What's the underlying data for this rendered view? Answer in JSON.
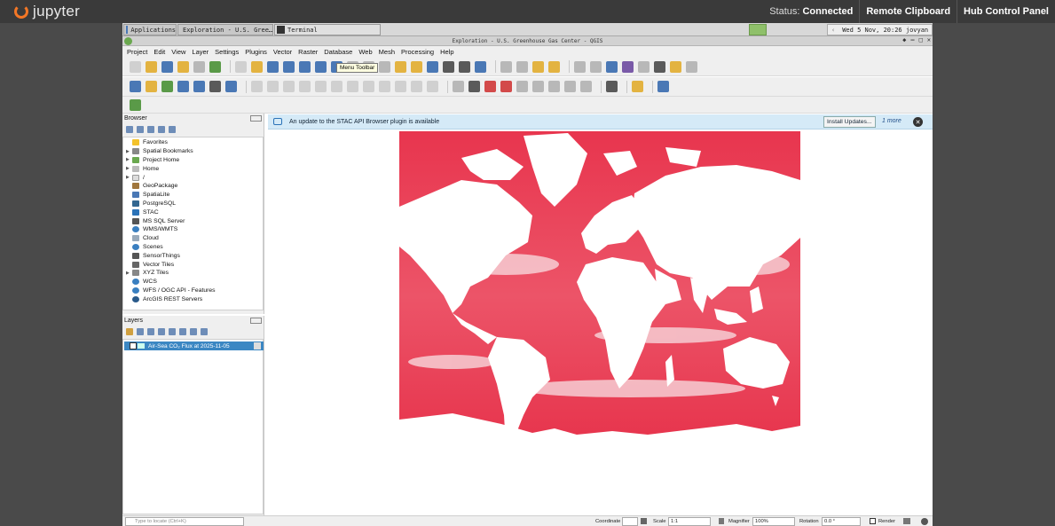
{
  "jupyter": {
    "logo_text": "jupyter",
    "status_label": "Status:",
    "status_value": "Connected",
    "buttons": [
      "Remote Clipboard",
      "Hub Control Panel"
    ]
  },
  "taskbar": {
    "tasks": [
      "Applications",
      "Exploration - U.S. Gree…",
      "Terminal"
    ],
    "clock": "Wed  5 Nov, 20:26  jovyan"
  },
  "window": {
    "title": "Exploration - U.S. Greenhouse Gas Center - QGIS",
    "controls": [
      "◆",
      "–",
      "□",
      "✕"
    ]
  },
  "menu": {
    "items": [
      "Project",
      "Edit",
      "View",
      "Layer",
      "Settings",
      "Plugins",
      "Vector",
      "Raster",
      "Database",
      "Web",
      "Mesh",
      "Processing",
      "Help"
    ],
    "tooltip": "Menu Toolbar"
  },
  "browser": {
    "title": "Browser",
    "items": [
      "Favorites",
      "Spatial Bookmarks",
      "Project Home",
      "Home",
      "/",
      "GeoPackage",
      "SpatiaLite",
      "PostgreSQL",
      "STAC",
      "MS SQL Server",
      "WMS/WMTS",
      "Cloud",
      "Scenes",
      "SensorThings",
      "Vector Tiles",
      "XYZ Tiles",
      "WCS",
      "WFS / OGC API - Features",
      "ArcGIS REST Servers"
    ]
  },
  "layers": {
    "title": "Layers",
    "layer_name": "Air-Sea CO₂ Flux at 2025-11-05"
  },
  "notice": {
    "text": "An update to the STAC API Browser plugin is available",
    "install_label": "Install Updates...",
    "more_label": "1 more"
  },
  "statusbar": {
    "locate_placeholder": "Type to locate (Ctrl+K)",
    "coordinate_label": "Coordinate",
    "scale_label": "Scale",
    "scale_value": "1:1",
    "magnifier_label": "Magnifier",
    "magnifier_value": "100%",
    "rotation_label": "Rotation",
    "rotation_value": "0.0 °",
    "render_label": "Render"
  },
  "colors": {
    "ocean": "#e8364f",
    "land": "#ffffff",
    "jupyter_orange": "#f37726",
    "selection": "#3b87c3"
  }
}
